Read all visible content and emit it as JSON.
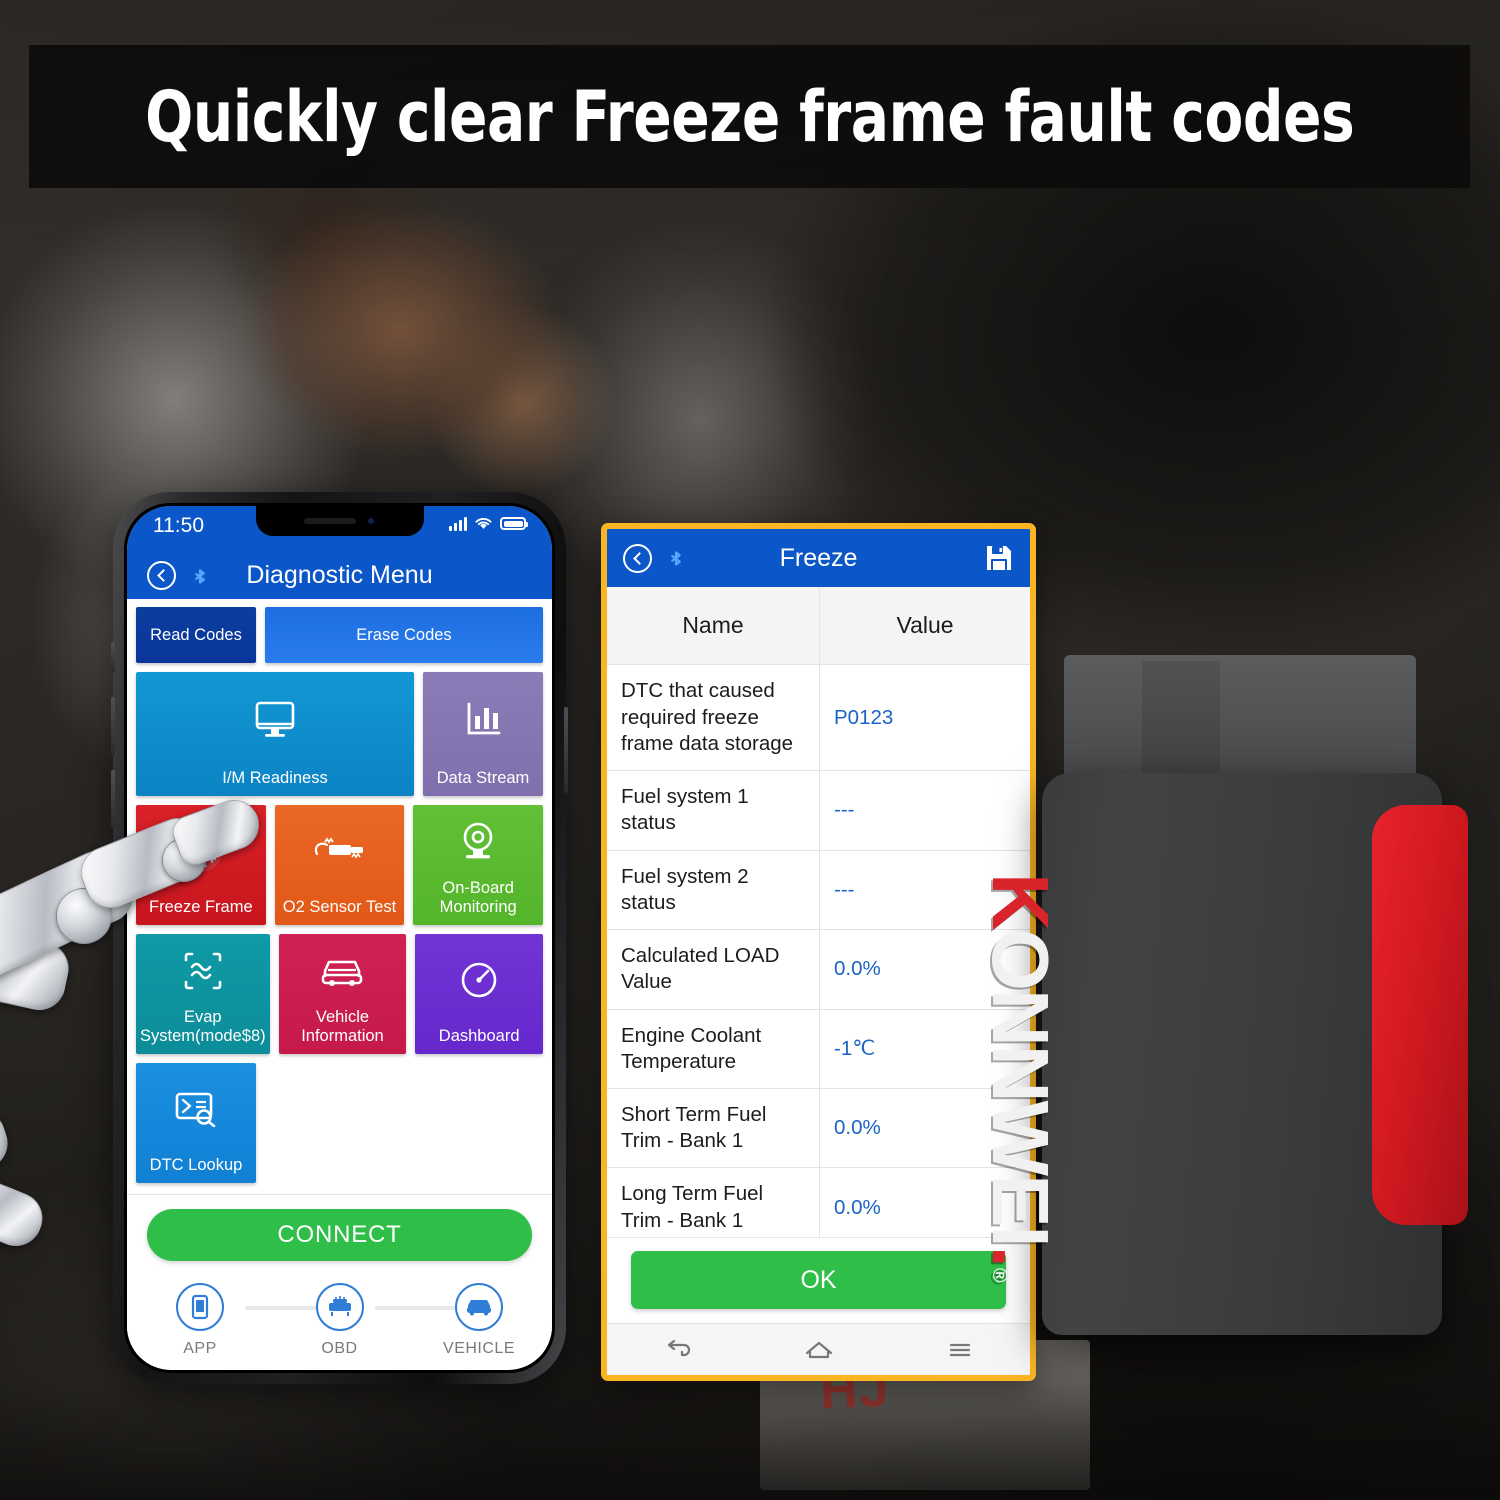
{
  "banner": {
    "headline": "Quickly clear Freeze frame fault codes"
  },
  "phone": {
    "status_bar": {
      "time": "11:50",
      "signal_icon": "signal-bars-icon",
      "wifi_icon": "wifi-icon",
      "battery_icon": "battery-icon"
    },
    "nav": {
      "back_icon": "back-circle-icon",
      "bluetooth_icon": "bluetooth-icon",
      "title": "Diagnostic Menu"
    },
    "menu_tiles": [
      {
        "label": "Read Codes",
        "icon": ""
      },
      {
        "label": "Erase Codes",
        "icon": ""
      },
      {
        "label": "I/M Readiness",
        "icon": "monitor-icon"
      },
      {
        "label": "Data Stream",
        "icon": "bar-chart-icon"
      },
      {
        "label": "Freeze Frame",
        "icon": "snowflake-icon"
      },
      {
        "label": "O2 Sensor Test",
        "icon": "oxygen-sensor-icon"
      },
      {
        "label": "On-Board Monitoring",
        "icon": "camera-target-icon"
      },
      {
        "label": "Evap System(mode$8)",
        "icon": "wave-box-icon"
      },
      {
        "label": "Vehicle Information",
        "icon": "car-icon"
      },
      {
        "label": "Dashboard",
        "icon": "gauge-icon"
      },
      {
        "label": "DTC Lookup",
        "icon": "card-search-icon"
      }
    ],
    "connect_label": "CONNECT",
    "steps": [
      {
        "label": "APP",
        "icon": "phone-icon"
      },
      {
        "label": "OBD",
        "icon": "obd-adapter-icon"
      },
      {
        "label": "VEHICLE",
        "icon": "car-front-icon"
      }
    ]
  },
  "freeze_panel": {
    "header": {
      "back_icon": "back-circle-icon",
      "bluetooth_icon": "bluetooth-icon",
      "title": "Freeze",
      "save_icon": "save-floppy-icon"
    },
    "columns": {
      "name": "Name",
      "value": "Value"
    },
    "rows": [
      {
        "name": "DTC that caused required freeze frame data storage",
        "value": "P0123"
      },
      {
        "name": "Fuel system 1 status",
        "value": "---"
      },
      {
        "name": "Fuel system 2 status",
        "value": "---"
      },
      {
        "name": "Calculated LOAD Value",
        "value": "0.0%"
      },
      {
        "name": "Engine Coolant Temperature",
        "value": "-1℃"
      },
      {
        "name": "Short Term Fuel Trim - Bank 1",
        "value": "0.0%"
      },
      {
        "name": "Long Term Fuel Trim - Bank 1",
        "value": "0.0%"
      }
    ],
    "ok_label": "OK",
    "nav_icons": [
      "back-arrow-icon",
      "home-icon",
      "menu-lines-icon"
    ]
  },
  "scanner": {
    "brand": "KONNWEI",
    "brand_mark": "registered-trademark-icon",
    "body_color": "#3a3b3d",
    "accent_color": "#d01820"
  },
  "background": {
    "watermark_text": "HJ"
  },
  "colors": {
    "nav_blue": "#0b56c8",
    "panel_border_yellow": "#f9b522",
    "green": "#2fbf48",
    "value_blue": "#1b63c4"
  }
}
